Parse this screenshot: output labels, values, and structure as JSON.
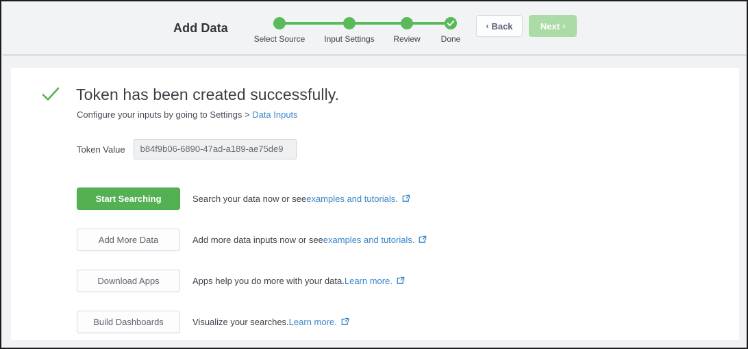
{
  "header": {
    "title": "Add Data",
    "steps": [
      {
        "label": "Select Source",
        "state": "complete",
        "icon": "dot-icon"
      },
      {
        "label": "Input Settings",
        "state": "complete",
        "icon": "dot-icon"
      },
      {
        "label": "Review",
        "state": "complete",
        "icon": "dot-icon"
      },
      {
        "label": "Done",
        "state": "current-complete",
        "icon": "check-circle-icon"
      }
    ],
    "back_label": "Back",
    "back_chevron": "‹",
    "next_label": "Next",
    "next_chevron": "›",
    "next_disabled": true
  },
  "main": {
    "success_icon": "checkmark-icon",
    "title": "Token has been created successfully.",
    "subtitle_prefix": "Configure your inputs by going to Settings > ",
    "subtitle_link": "Data Inputs",
    "token_label": "Token Value",
    "token_value": "b84f9b06-6890-47ad-a189-ae75de9",
    "rows": [
      {
        "button_label": "Start Searching",
        "button_style": "primary",
        "desc_prefix": "Search your data now or see ",
        "desc_link": "examples and tutorials.",
        "desc_suffix": "",
        "external_icon": "external-link-icon"
      },
      {
        "button_label": "Add More Data",
        "button_style": "secondary",
        "desc_prefix": "Add more data inputs now or see ",
        "desc_link": "examples and tutorials.",
        "desc_suffix": "",
        "external_icon": "external-link-icon"
      },
      {
        "button_label": "Download Apps",
        "button_style": "secondary",
        "desc_prefix": "Apps help you do more with your data. ",
        "desc_link": "Learn more.",
        "desc_suffix": "",
        "external_icon": "external-link-icon"
      },
      {
        "button_label": "Build Dashboards",
        "button_style": "secondary",
        "desc_prefix": "Visualize your searches. ",
        "desc_link": "Learn more.",
        "desc_suffix": "",
        "external_icon": "external-link-icon"
      }
    ]
  },
  "colors": {
    "green": "#53b153",
    "green_step": "#5aba5a",
    "green_disabled": "#a8daa2",
    "link_blue": "#3a86c8",
    "header_bg": "#f2f3f4",
    "body_bg": "#f1f2f4",
    "card_bg": "#ffffff",
    "text_dark": "#3b3d45"
  }
}
